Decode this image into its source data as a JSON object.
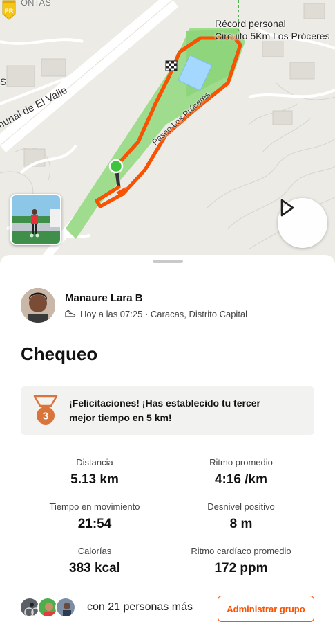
{
  "map": {
    "labels": {
      "road": "munal de El Valle",
      "road_fragment": "S",
      "top_fragment": "ONTAS",
      "paseo": "Paseo Los Próceres"
    },
    "personal_record": {
      "badge": "PR",
      "line1": "Récord personal",
      "line2": "Circuito 5Km Los Próceres"
    },
    "play_icon": "play-icon",
    "route_color": "#fc5200"
  },
  "activity": {
    "athlete_name": "Manaure Lara B",
    "meta": "Hoy a las 07:25 · Caracas, Distrito Capital",
    "title": "Chequeo",
    "achievement": {
      "rank": "3",
      "line1": "¡Felicitaciones! ¡Has establecido tu tercer",
      "line2": "mejor tiempo en 5 km!"
    },
    "stats": {
      "distance": {
        "label": "Distancia",
        "value": "5.13 km"
      },
      "pace": {
        "label": "Ritmo promedio",
        "value": "4:16 /km"
      },
      "moving_time": {
        "label": "Tiempo en movimiento",
        "value": "21:54"
      },
      "elevation": {
        "label": "Desnivel positivo",
        "value": "8 m"
      },
      "calories": {
        "label": "Calorías",
        "value": "383 kcal"
      },
      "heart_rate": {
        "label": "Ritmo cardíaco promedio",
        "value": "172 ppm"
      }
    },
    "group": {
      "text": "con 21 personas más",
      "button": "Administrar grupo"
    }
  },
  "colors": {
    "accent": "#fc5200",
    "park": "#9fdc8e",
    "badge": "#f5c518"
  }
}
